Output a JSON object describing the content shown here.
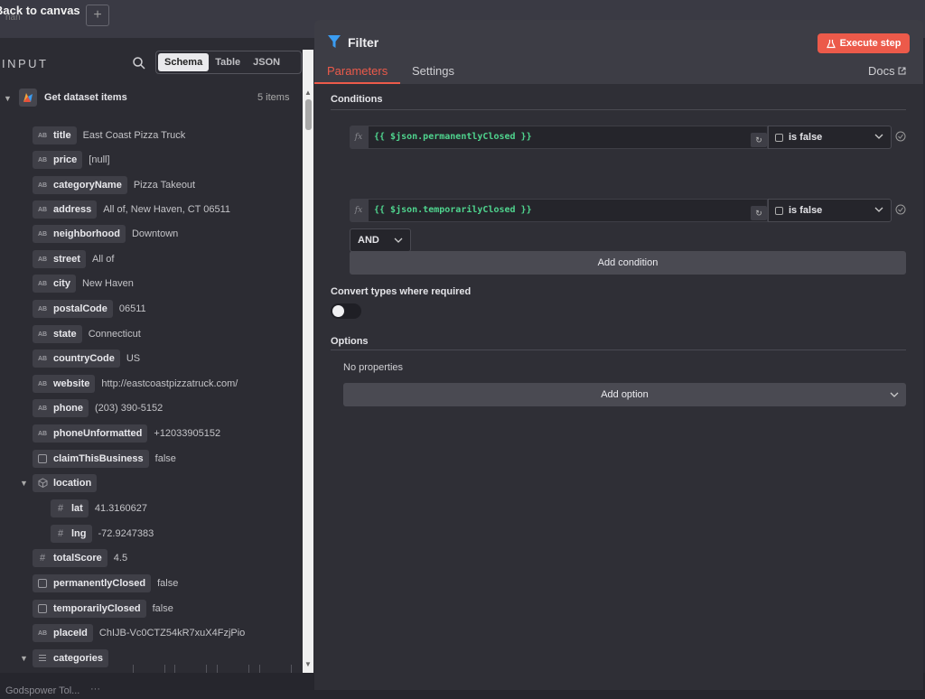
{
  "topbar": {
    "back_label": "Back to canvas",
    "back_sub": "nan",
    "add_glyph": "+"
  },
  "input": {
    "title": "INPUT",
    "tabs": [
      "Schema",
      "Table",
      "JSON"
    ],
    "node": {
      "name": "Get dataset items",
      "count": "5 items"
    },
    "fields": [
      {
        "name": "title",
        "value": "East Coast Pizza Truck",
        "type": "string"
      },
      {
        "name": "price",
        "value": "[null]",
        "type": "string"
      },
      {
        "name": "categoryName",
        "value": "Pizza Takeout",
        "type": "string"
      },
      {
        "name": "address",
        "value": "All of, New Haven, CT 06511",
        "type": "string"
      },
      {
        "name": "neighborhood",
        "value": "Downtown",
        "type": "string"
      },
      {
        "name": "street",
        "value": "All of",
        "type": "string"
      },
      {
        "name": "city",
        "value": "New Haven",
        "type": "string"
      },
      {
        "name": "postalCode",
        "value": "06511",
        "type": "string"
      },
      {
        "name": "state",
        "value": "Connecticut",
        "type": "string"
      },
      {
        "name": "countryCode",
        "value": "US",
        "type": "string"
      },
      {
        "name": "website",
        "value": "http://eastcoastpizzatruck.com/",
        "type": "string"
      },
      {
        "name": "phone",
        "value": "(203) 390-5152",
        "type": "string"
      },
      {
        "name": "phoneUnformatted",
        "value": "+12033905152",
        "type": "string"
      },
      {
        "name": "claimThisBusiness",
        "value": "false",
        "type": "boolean"
      },
      {
        "name": "location",
        "value": "",
        "type": "object"
      },
      {
        "name": "lat",
        "value": "41.3160627",
        "type": "number"
      },
      {
        "name": "lng",
        "value": "-72.9247383",
        "type": "number"
      },
      {
        "name": "totalScore",
        "value": "4.5",
        "type": "number"
      },
      {
        "name": "permanentlyClosed",
        "value": "false",
        "type": "boolean"
      },
      {
        "name": "temporarilyClosed",
        "value": "false",
        "type": "boolean"
      },
      {
        "name": "placeId",
        "value": "ChIJB-Vc0CTZ54kR7xuX4FzjPio",
        "type": "string"
      },
      {
        "name": "categories",
        "value": "",
        "type": "array"
      }
    ],
    "type_labels": {
      "string": "AB",
      "number": "#"
    }
  },
  "footer": {
    "label": "Godspower Tol...",
    "dots": "···"
  },
  "filter": {
    "title": "Filter",
    "execute_label": "Execute step",
    "tabs": [
      "Parameters",
      "Settings"
    ],
    "docs_label": "Docs",
    "conditions_label": "Conditions",
    "conditions": [
      {
        "expression": "{{ $json.permanentlyClosed }}",
        "operator": "is false"
      },
      {
        "expression": "{{ $json.temporarilyClosed }}",
        "operator": "is false"
      }
    ],
    "fx_label": "fx",
    "corner_glyph": "↻",
    "combinator": "AND",
    "add_condition_label": "Add condition",
    "convert_label": "Convert types where required",
    "convert_enabled": false,
    "options_label": "Options",
    "no_properties_label": "No properties",
    "add_option_label": "Add option"
  },
  "colors": {
    "accent": "#ec5a4a",
    "expression": "#4fd48e",
    "filter_icon": "#3b9df2"
  }
}
